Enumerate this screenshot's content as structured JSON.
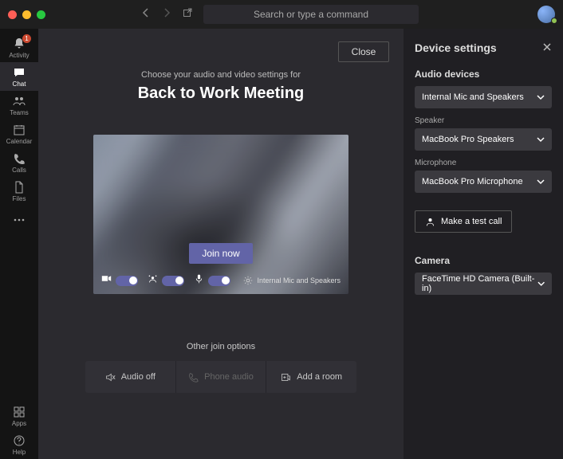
{
  "search_placeholder": "Search or type a command",
  "sidebar": {
    "activity": "Activity",
    "activity_badge": "1",
    "chat": "Chat",
    "teams": "Teams",
    "calendar": "Calendar",
    "calls": "Calls",
    "files": "Files",
    "apps": "Apps",
    "help": "Help"
  },
  "meeting": {
    "close": "Close",
    "subtitle": "Choose your audio and video settings for",
    "title": "Back to Work Meeting",
    "join": "Join now",
    "device_summary": "Internal Mic and Speakers",
    "other_options": "Other join options",
    "audio_off": "Audio off",
    "phone_audio": "Phone audio",
    "add_room": "Add a room"
  },
  "settings": {
    "heading": "Device settings",
    "audio_devices": "Audio devices",
    "audio_value": "Internal Mic and Speakers",
    "speaker_label": "Speaker",
    "speaker_value": "MacBook Pro Speakers",
    "mic_label": "Microphone",
    "mic_value": "MacBook Pro Microphone",
    "test_call": "Make a test call",
    "camera_label": "Camera",
    "camera_value": "FaceTime HD Camera (Built-in)"
  }
}
